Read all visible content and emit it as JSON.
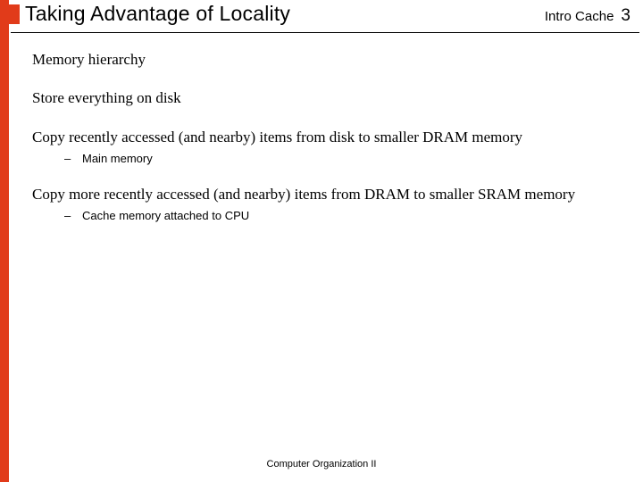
{
  "accent_color": "#e13b1a",
  "header": {
    "title": "Taking Advantage of Locality",
    "section": "Intro Cache",
    "page": "3"
  },
  "body": {
    "p1": "Memory hierarchy",
    "p2": "Store everything on disk",
    "p3": "Copy recently accessed (and nearby) items from disk to smaller DRAM memory",
    "p3_sub1": "Main memory",
    "p4": "Copy more recently accessed (and nearby) items from DRAM to smaller SRAM memory",
    "p4_sub1": "Cache memory attached to CPU"
  },
  "footer": "Computer Organization II"
}
